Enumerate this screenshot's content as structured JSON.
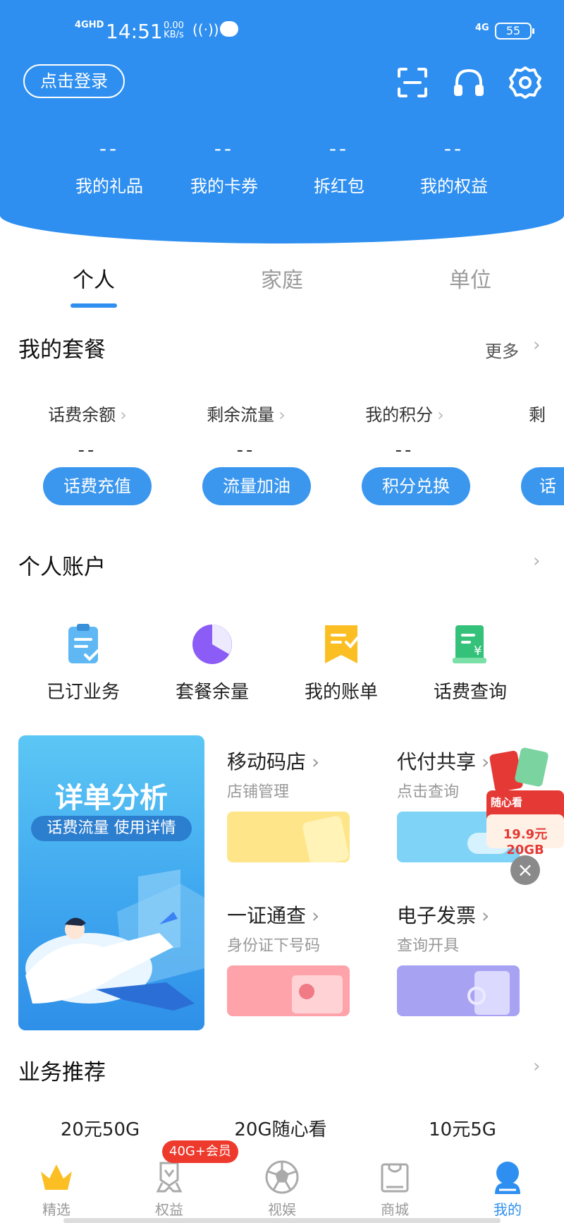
{
  "status_bar": {
    "signal": "4GHD",
    "time": "14:51",
    "net_speed": "0.00",
    "net_unit": "KB/s",
    "lte": "4G",
    "battery": "55"
  },
  "header": {
    "login_label": "点击登录",
    "stats": [
      {
        "value": "--",
        "label": "我的礼品"
      },
      {
        "value": "--",
        "label": "我的卡券"
      },
      {
        "value": "--",
        "label": "拆红包"
      },
      {
        "value": "--",
        "label": "我的权益"
      }
    ]
  },
  "tabs": [
    "个人",
    "家庭",
    "单位"
  ],
  "package": {
    "title": "我的套餐",
    "more": "更多",
    "items": [
      {
        "label": "话费余额",
        "value": "--",
        "button": "话费充值"
      },
      {
        "label": "剩余流量",
        "value": "--",
        "button": "流量加油"
      },
      {
        "label": "我的积分",
        "value": "--",
        "button": "积分兑换"
      },
      {
        "label": "剩",
        "value": "",
        "button": "话"
      }
    ]
  },
  "account": {
    "title": "个人账户",
    "items": [
      {
        "label": "已订业务"
      },
      {
        "label": "套餐余量"
      },
      {
        "label": "我的账单"
      },
      {
        "label": "话费查询"
      }
    ]
  },
  "banner": {
    "title": "详单分析",
    "subtitle": "话费流量 使用详情"
  },
  "services": [
    {
      "title": "移动码店",
      "subtitle": "店铺管理"
    },
    {
      "title": "代付共享",
      "subtitle": "点击查询"
    },
    {
      "title": "一证通查",
      "subtitle": "身份证下号码"
    },
    {
      "title": "电子发票",
      "subtitle": "查询开具"
    }
  ],
  "promo": {
    "tag": "随心看",
    "price": "19.9元20GB"
  },
  "recommend": {
    "title": "业务推荐",
    "items": [
      "20元50G",
      "20G随心看",
      "10元5G"
    ]
  },
  "bottom_nav": {
    "badge": "40G+会员",
    "items": [
      "精选",
      "权益",
      "视娱",
      "商城",
      "我的"
    ]
  },
  "colors": {
    "brand": "#2e8ff0",
    "button": "#3b97ee"
  }
}
